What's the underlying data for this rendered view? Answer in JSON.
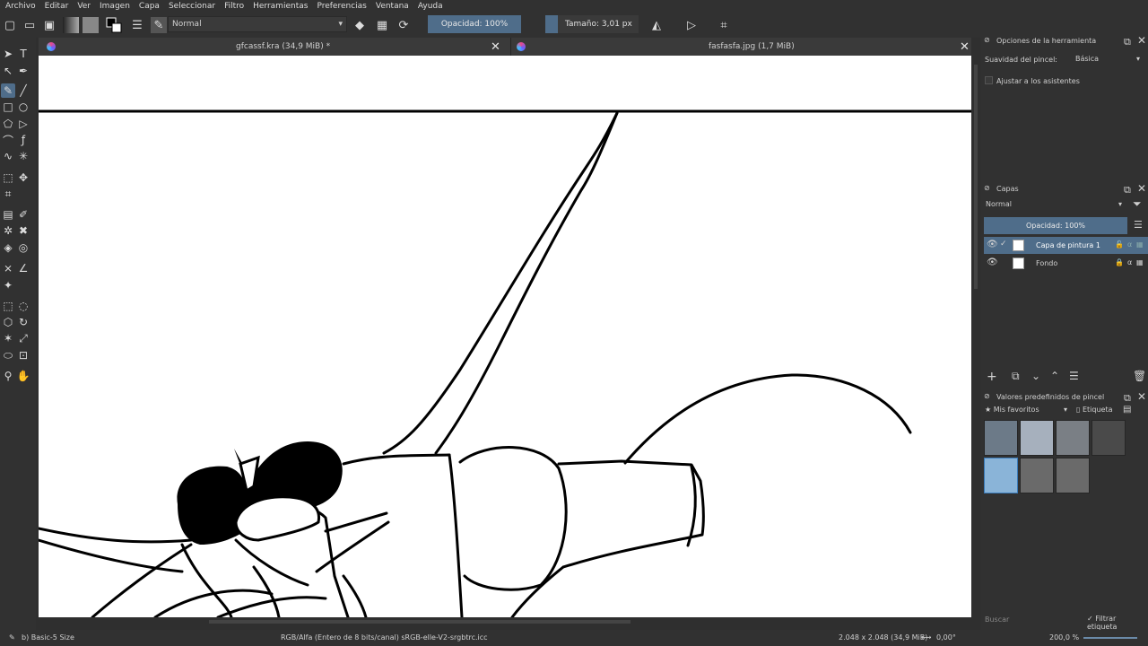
{
  "menu": [
    "Archivo",
    "Editar",
    "Ver",
    "Imagen",
    "Capa",
    "Seleccionar",
    "Filtro",
    "Herramientas",
    "Preferencias",
    "Ventana",
    "Ayuda"
  ],
  "toolbar": {
    "blend_mode": "Normal",
    "opacity": "Opacidad: 100%",
    "size": "Tamaño: 3,01 px"
  },
  "tabs": [
    {
      "title": "gfcassf.kra (34,9 MiB) *"
    },
    {
      "title": "fasfasfa.jpg (1,7 MiB)"
    }
  ],
  "tool_options": {
    "title": "Opciones de la herramienta",
    "smoothing_label": "Suavidad del pincel:",
    "smoothing_value": "Básica",
    "assistants_label": "Ajustar a los asistentes"
  },
  "layers": {
    "title": "Capas",
    "blend_mode": "Normal",
    "opacity": "Opacidad:  100%",
    "items": [
      {
        "name": "Capa de pintura 1",
        "selected": true
      },
      {
        "name": "Fondo",
        "selected": false
      }
    ]
  },
  "presets": {
    "title": "Valores predefinidos de pincel",
    "filter": "Mis favoritos",
    "tag_button": "Etiqueta",
    "search_placeholder": "Buscar",
    "filter_tag_label": "Filtrar etiqueta"
  },
  "status": {
    "brush": "b) Basic-5 Size",
    "color_profile": "RGB/Alfa (Entero de 8 bits/canal)  sRGB-elle-V2-srgbtrc.icc",
    "dimensions": "2.048 x 2.048 (34,9 MiB)",
    "rotation": "0,00°",
    "zoom": "200,0 %"
  },
  "colors": {
    "accent": "#4f6d8a",
    "background": "#313131"
  }
}
